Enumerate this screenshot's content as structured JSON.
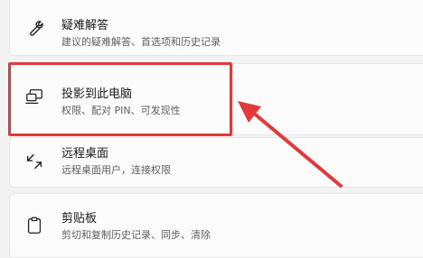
{
  "items": [
    {
      "title": "疑难解答",
      "subtitle": "建议的疑难解答、首选项和历史记录",
      "icon": "wrench-icon"
    },
    {
      "title": "投影到此电脑",
      "subtitle": "权限、配对 PIN、可发现性",
      "icon": "project-to-pc-icon"
    },
    {
      "title": "远程桌面",
      "subtitle": "远程桌面用户，连接权限",
      "icon": "remote-desktop-icon"
    },
    {
      "title": "剪贴板",
      "subtitle": "剪切和复制历史记录、同步、清除",
      "icon": "clipboard-icon"
    }
  ],
  "colors": {
    "highlight": "#e23a3a",
    "background": "#f3f3f3",
    "card": "#fbfbfb"
  }
}
